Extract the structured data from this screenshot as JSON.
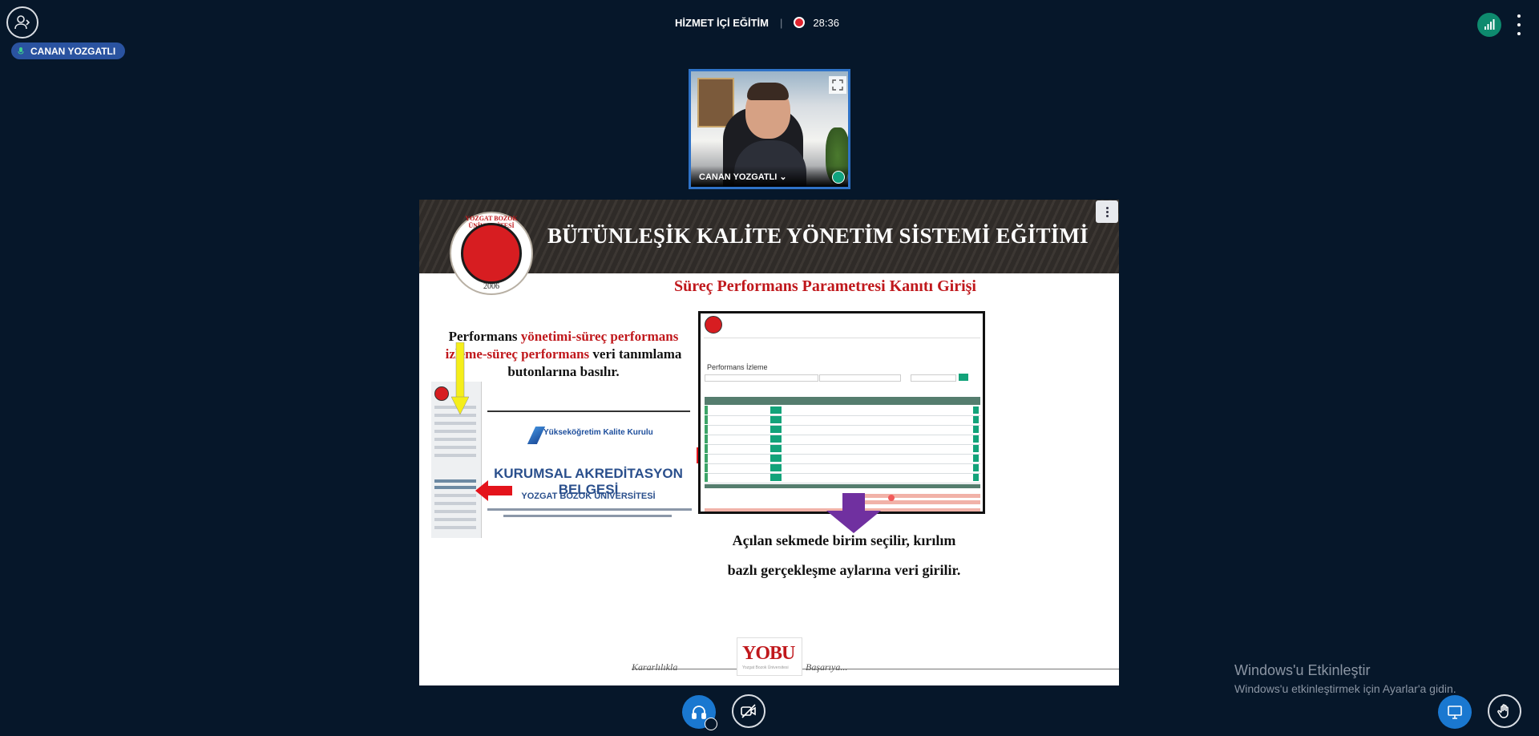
{
  "meeting": {
    "title": "HİZMET İÇİ EĞİTİM",
    "timer": "28:36"
  },
  "presenter": {
    "name": "CANAN YOZGATLI"
  },
  "webcam": {
    "name": "CANAN YOZGATLI ⌄"
  },
  "slide": {
    "title": "BÜTÜNLEŞİK KALİTE YÖNETİM SİSTEMİ EĞİTİMİ",
    "subtitle": "Süreç Performans Parametresi Kanıtı Girişi",
    "logo_text": "YOZGAT BOZOK ÜNİVERSİTESİ",
    "logo_year": "2006",
    "left_text": {
      "p1": "Performans ",
      "p2": "yönetimi-süreç performans izleme-süreç performans",
      "p3": " veri tanımlama butonlarına basılır."
    },
    "screenshot_left": {
      "brand": "Yükseköğretim Kalite Kurulu",
      "heading": "KURUMSAL AKREDİTASYON BELGESİ",
      "university": "YOZGAT BOZOK ÜNİVERSİTESİ"
    },
    "screenshot_right": {
      "page_title": "Performans İzleme"
    },
    "bottom_text": "Açılan sekmede birim seçilir, kırılım bazlı gerçekleşme aylarına veri girilir.",
    "footer_left": "Kararlılıkla",
    "footer_right": "Başarıya...",
    "footer_logo": "YOBU",
    "footer_logo_sub": "Yozgat Bozok Üniversitesi"
  },
  "watermark": {
    "title": "Windows'u Etkinleştir",
    "subtitle": "Windows'u etkinleştirmek için Ayarlar'a gidin."
  },
  "colors": {
    "accent": "#1a78d0",
    "record": "#e0222c",
    "connection": "#0e8a6e",
    "badge": "#2a53a0"
  },
  "icons": [
    "users-icon",
    "microphone-icon",
    "record-icon",
    "signal-icon",
    "more-vertical-icon",
    "expand-icon",
    "headphones-icon",
    "video-off-icon",
    "screen-share-icon",
    "raise-hand-icon"
  ]
}
